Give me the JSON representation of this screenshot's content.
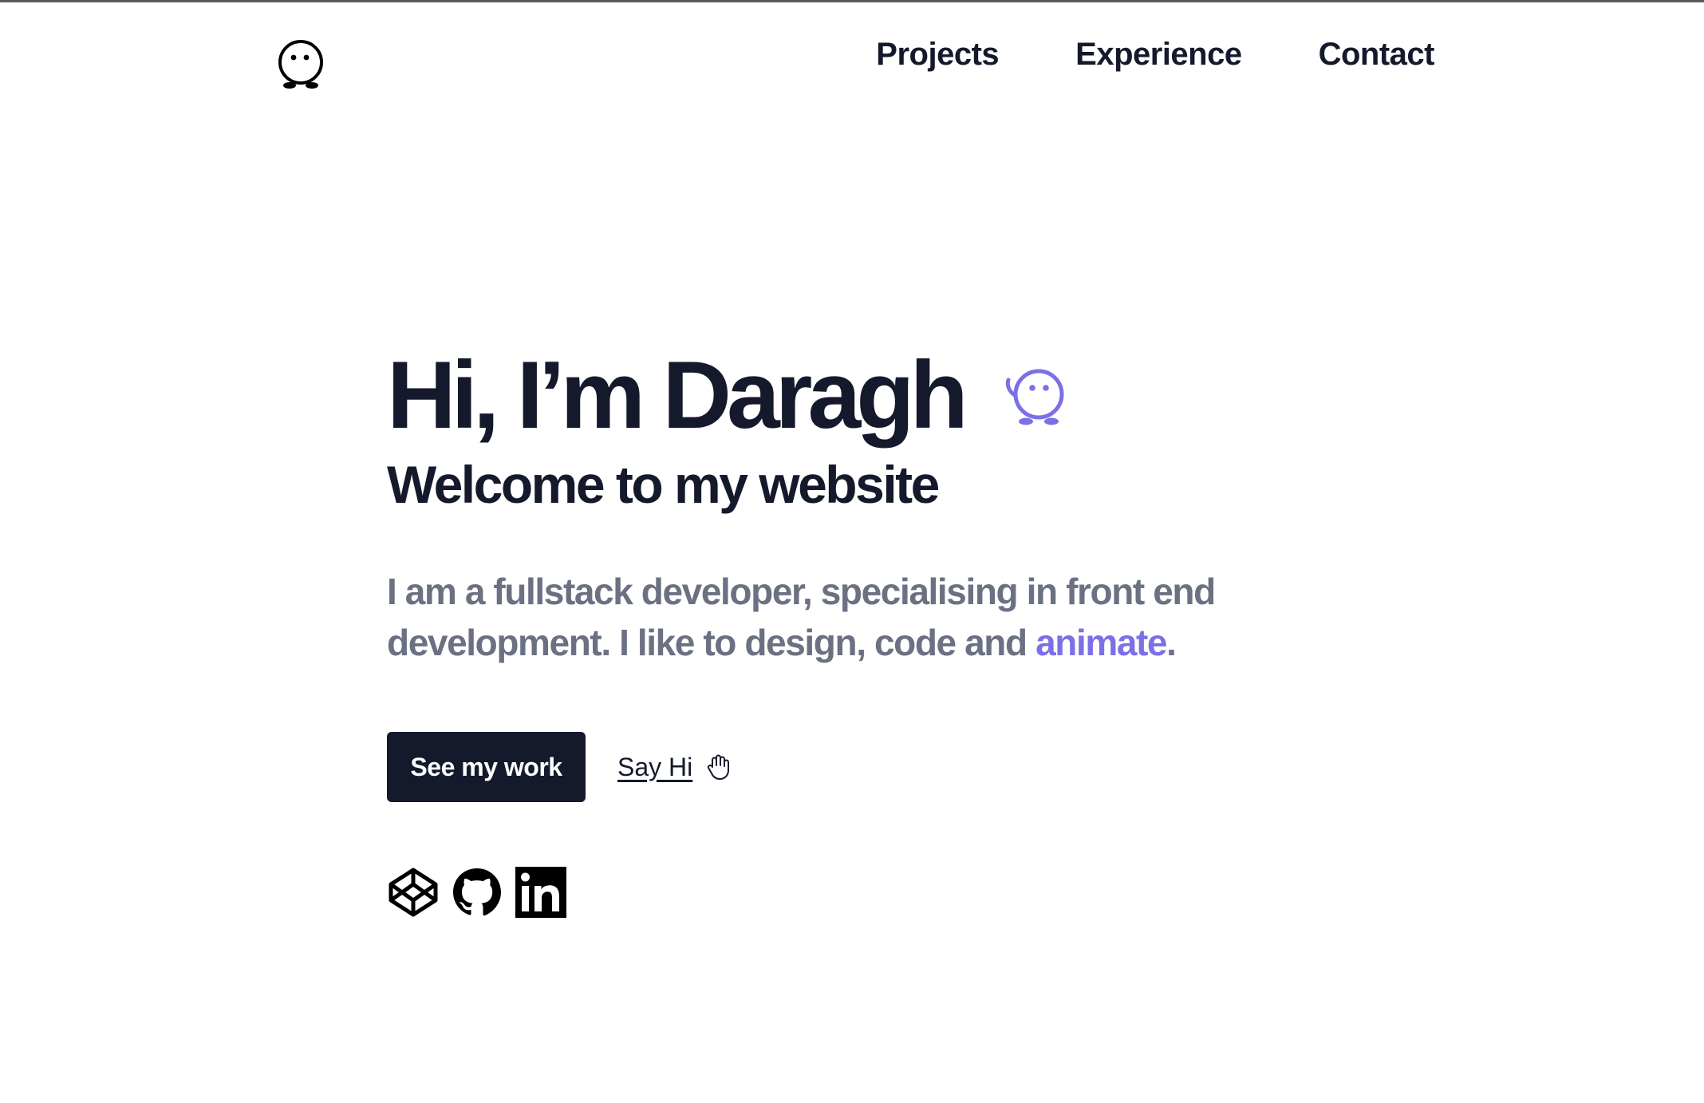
{
  "nav": {
    "items": [
      {
        "label": "Projects"
      },
      {
        "label": "Experience"
      },
      {
        "label": "Contact"
      }
    ]
  },
  "hero": {
    "title": "Hi, I’m Daragh",
    "subtitle": "Welcome to my website",
    "intro_text": "I am a fullstack developer, specialising in front end development. I like to design, code and ",
    "intro_accent": "animate",
    "intro_end": ".",
    "primary_button": "See my work",
    "secondary_link": "Say Hi"
  },
  "icons": {
    "logo": "ghost-face-icon",
    "mascot": "waving-ghost-icon",
    "hand": "waving-hand-icon",
    "social": [
      "codepen-icon",
      "github-icon",
      "linkedin-icon"
    ]
  },
  "colors": {
    "text": "#141a2b",
    "muted": "#6b7182",
    "accent": "#7b70e6"
  }
}
